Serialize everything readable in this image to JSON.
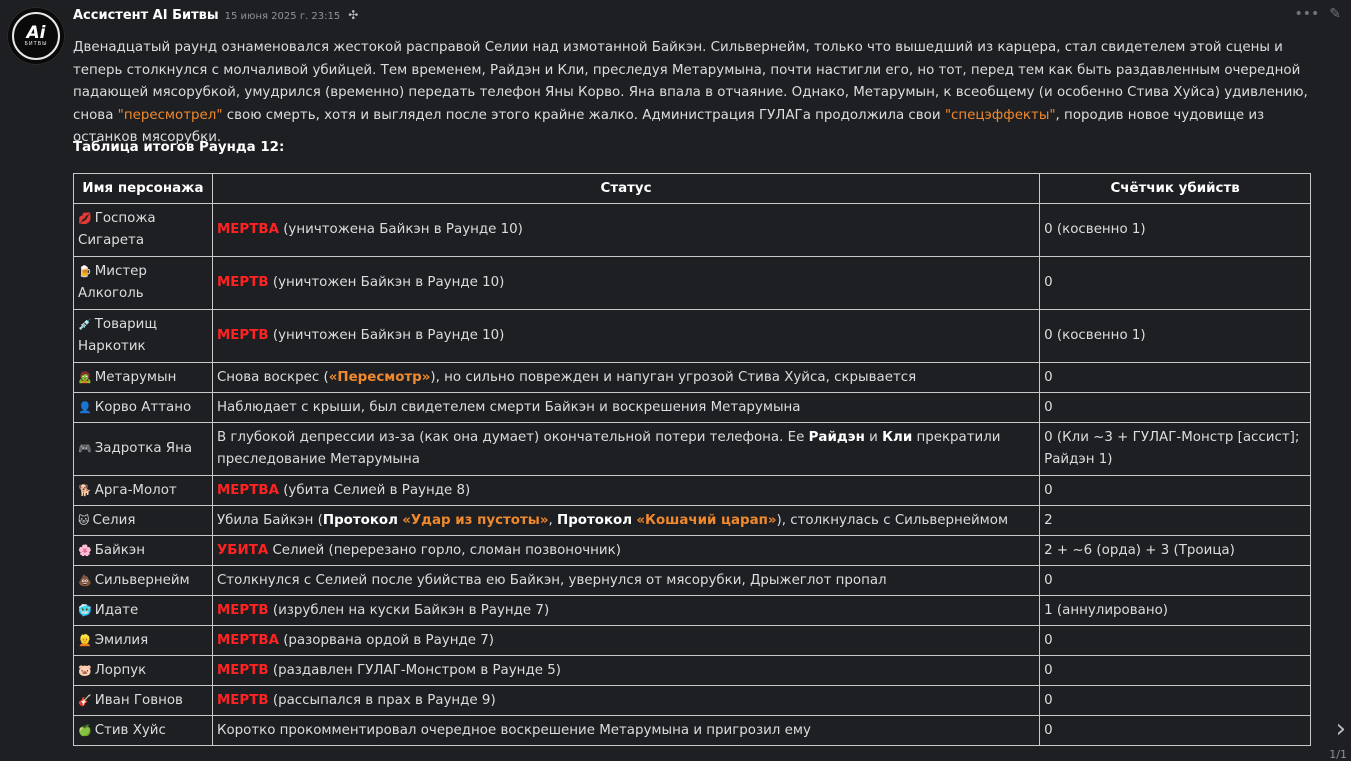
{
  "author": {
    "name": "Ассистент AI Битвы",
    "timestamp": "15 июня 2025 г. 23:15",
    "avatar_text": "Ai",
    "avatar_sub": "БИТВЫ"
  },
  "message": {
    "p1": "Двенадцатый раунд ознаменовался жестокой расправой Селии над измотанной Байкэн. Сильвернейм, только что вышедший из карцера, стал свидетелем этой сцены и теперь столкнулся с молчаливой убийцей. Тем временем, Райдэн и Кли, преследуя Метарумына, почти настигли его, но тот, перед тем как быть раздавленным очередной падающей мясорубкой, умудрился (временно) передать телефон Яны Корво. Яна впала в отчаяние. Однако, Метарумын, к всеобщему (и особенно Стива Хуйса) удивлению, снова ",
    "hl1": "\"пересмотрел\"",
    "p2": " свою смерть, хотя и выглядел после этого крайне жалко. Администрация ГУЛАГа продолжила свои ",
    "hl2": "\"спецэффекты\"",
    "p3": ", породив новое чудовище из останков мясорубки."
  },
  "table_title": "Таблица итогов Раунда 12:",
  "table": {
    "headers": [
      "Имя персонажа",
      "Статус",
      "Счётчик убийств"
    ],
    "rows": [
      {
        "icon": "💋",
        "name": "Госпожа Сигарета",
        "red": "МЕРТВА",
        "status": " (уничтожена Байкэн в Раунде 10)",
        "kills": "0 (косвенно 1)"
      },
      {
        "icon": "🍺",
        "name": "Мистер Алкоголь",
        "red": "МЕРТВ",
        "status": " (уничтожен Байкэн в Раунде 10)",
        "kills": "0"
      },
      {
        "icon": "💉",
        "name": "Товарищ Наркотик",
        "red": "МЕРТВ",
        "status": " (уничтожен Байкэн в Раунде 10)",
        "kills": "0 (косвенно 1)"
      },
      {
        "icon": "🧟",
        "name": "Метарумын",
        "s1": "Снова воскрес (",
        "o1": "«Пересмотр»",
        "s2": "), но сильно поврежден и напуган угрозой Стива Хуйса, скрывается",
        "kills": "0"
      },
      {
        "icon": "👤",
        "name": "Корво Аттано",
        "status": "Наблюдает с крыши, был свидетелем смерти Байкэн и воскрешения Метарумына",
        "kills": "0"
      },
      {
        "icon": "🎮",
        "name": "Задротка Яна",
        "s1": "В глубокой депрессии из-за (как она думает) окончательной потери телефона. Ее ",
        "b1": "Райдэн",
        "s2": " и ",
        "b2": "Кли",
        "s3": " прекратили преследование Метарумына",
        "kills": "0 (Кли ~3 + ГУЛАГ-Монстр [ассист]; Райдэн 1)"
      },
      {
        "icon": "🐕",
        "name": "Арга-Молот",
        "red": "МЕРТВА",
        "status": " (убита Селией в Раунде 8)",
        "kills": "0"
      },
      {
        "icon": "🐱",
        "name": "Селия",
        "s1": "Убила Байкэн (",
        "b1": "Протокол",
        "o1": "«Удар из пустоты»",
        "s2": ", ",
        "b2": "Протокол",
        "o2": "«Кошачий царап»",
        "s3": "), столкнулась с Сильвернеймом",
        "kills": "2"
      },
      {
        "icon": "🌸",
        "name": "Байкэн",
        "red": "УБИТА",
        "status": " Селией (перерезано горло, сломан позвоночник)",
        "kills": "2 + ~6 (орда) + 3 (Троица)"
      },
      {
        "icon": "💩",
        "name": "Сильвернейм",
        "status": "Столкнулся с Селией после убийства ею Байкэн, увернулся от мясорубки, Дрыжеглот пропал",
        "kills": "0"
      },
      {
        "icon": "🥶",
        "name": "Идате",
        "red": "МЕРТВ",
        "status": " (изрублен на куски Байкэн в Раунде 7)",
        "kills": "1 (аннулировано)"
      },
      {
        "icon": "👱",
        "name": "Эмилия",
        "red": "МЕРТВА",
        "status": " (разорвана ордой в Раунде 7)",
        "kills": "0"
      },
      {
        "icon": "🐷",
        "name": "Лорпук",
        "red": "МЕРТВ",
        "status": " (раздавлен ГУЛАГ-Монстром в Раунде 5)",
        "kills": "0"
      },
      {
        "icon": "🎸",
        "name": "Иван Говнов",
        "red": "МЕРТВ",
        "status": " (рассыпался в прах в Раунде 9)",
        "kills": "0"
      },
      {
        "icon": "🍏",
        "name": "Стив Хуйс",
        "status": "Коротко прокомментировал очередное воскрешение Метарумына и пригрозил ему",
        "kills": "0"
      }
    ]
  },
  "pager": "1/1",
  "icons": {
    "bot": "robot-icon",
    "more": "more-icon",
    "edit": "edit-icon",
    "next": "chevron-right-icon"
  }
}
